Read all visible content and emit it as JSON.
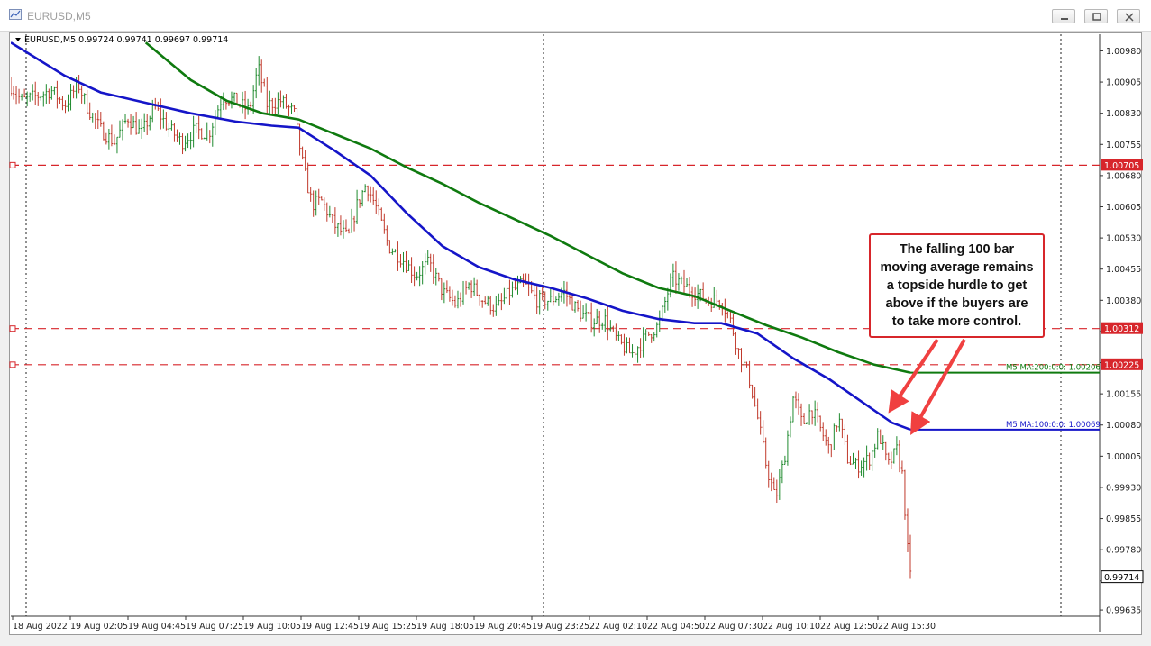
{
  "window": {
    "title": "EURUSD,M5"
  },
  "chart_data": {
    "type": "candlestick",
    "symbol_header": "EURUSD,M5  0.99724 0.99741 0.99697 0.99714",
    "y_ticks": [
      1.0098,
      1.00905,
      1.0083,
      1.00755,
      1.0068,
      1.00605,
      1.0053,
      1.00455,
      1.0038,
      1.00305,
      1.0023,
      1.00155,
      1.0008,
      1.00005,
      0.9993,
      0.99855,
      0.9978,
      0.99705,
      0.99635
    ],
    "y_tick_labels": [
      "1.00980",
      "1.00905",
      "1.00830",
      "1.00755",
      "1.00680",
      "1.00605",
      "1.00530",
      "1.00455",
      "1.00380",
      "",
      "",
      "1.00155",
      "1.00080",
      "1.00005",
      "0.99930",
      "0.99855",
      "0.99780",
      "",
      "0.99635"
    ],
    "ylim": [
      0.9962,
      1.0102
    ],
    "x_tick_labels": [
      "18 Aug 2022",
      "19 Aug 02:05",
      "19 Aug 04:45",
      "19 Aug 07:25",
      "19 Aug 10:05",
      "19 Aug 12:45",
      "19 Aug 15:25",
      "19 Aug 18:05",
      "19 Aug 20:45",
      "19 Aug 23:25",
      "22 Aug 02:10",
      "22 Aug 04:50",
      "22 Aug 07:30",
      "22 Aug 10:10",
      "22 Aug 12:50",
      "22 Aug 15:30"
    ],
    "horizontal_levels": [
      {
        "value": 1.00705,
        "label": "1.00705"
      },
      {
        "value": 1.00312,
        "label": "1.00312"
      },
      {
        "value": 1.00225,
        "label": "1.00225"
      }
    ],
    "last_price": {
      "value": 0.99714,
      "label": "0.99714"
    },
    "price_path": [
      [
        0.0,
        1.00895
      ],
      [
        0.012,
        1.0086
      ],
      [
        0.03,
        1.00872
      ],
      [
        0.045,
        1.00885
      ],
      [
        0.06,
        1.0085
      ],
      [
        0.075,
        1.009
      ],
      [
        0.085,
        1.00845
      ],
      [
        0.1,
        1.0079
      ],
      [
        0.115,
        1.0076
      ],
      [
        0.13,
        1.0082
      ],
      [
        0.145,
        1.0078
      ],
      [
        0.16,
        1.00845
      ],
      [
        0.175,
        1.00795
      ],
      [
        0.19,
        1.0076
      ],
      [
        0.205,
        1.0079
      ],
      [
        0.22,
        1.0078
      ],
      [
        0.235,
        1.0087
      ],
      [
        0.25,
        1.0086
      ],
      [
        0.265,
        1.00835
      ],
      [
        0.275,
        1.0094
      ],
      [
        0.285,
        1.0085
      ],
      [
        0.3,
        1.0086
      ],
      [
        0.315,
        1.0083
      ],
      [
        0.325,
        1.007
      ],
      [
        0.335,
        1.0061
      ],
      [
        0.345,
        1.0062
      ],
      [
        0.36,
        1.0056
      ],
      [
        0.375,
        1.0053
      ],
      [
        0.385,
        1.0061
      ],
      [
        0.395,
        1.0066
      ],
      [
        0.405,
        1.0061
      ],
      [
        0.42,
        1.0051
      ],
      [
        0.435,
        1.0048
      ],
      [
        0.45,
        1.0044
      ],
      [
        0.465,
        1.0047
      ],
      [
        0.48,
        1.004
      ],
      [
        0.495,
        1.0037
      ],
      [
        0.51,
        1.0042
      ],
      [
        0.525,
        1.0038
      ],
      [
        0.54,
        1.0036
      ],
      [
        0.555,
        1.004
      ],
      [
        0.57,
        1.0042
      ],
      [
        0.585,
        1.0038
      ],
      [
        0.6,
        1.0038
      ],
      [
        0.615,
        1.004
      ],
      [
        0.63,
        1.00355
      ],
      [
        0.645,
        1.0033
      ],
      [
        0.66,
        1.00335
      ],
      [
        0.675,
        1.0028
      ],
      [
        0.69,
        1.0025
      ],
      [
        0.705,
        1.0029
      ],
      [
        0.72,
        1.0032
      ],
      [
        0.735,
        1.00435
      ],
      [
        0.745,
        1.0042
      ],
      [
        0.76,
        1.004
      ],
      [
        0.775,
        1.0038
      ],
      [
        0.79,
        1.0038
      ],
      [
        0.8,
        1.0033
      ],
      [
        0.81,
        1.0025
      ],
      [
        0.82,
        1.002
      ],
      [
        0.83,
        1.001
      ],
      [
        0.84,
        0.9998
      ],
      [
        0.85,
        0.999
      ],
      [
        0.86,
        1.0
      ],
      [
        0.87,
        1.0015
      ],
      [
        0.88,
        1.0008
      ],
      [
        0.89,
        1.0012
      ],
      [
        0.9,
        1.0007
      ],
      [
        0.91,
        1.0002
      ],
      [
        0.92,
        1.001
      ],
      [
        0.93,
        1.0
      ],
      [
        0.94,
        0.9998
      ],
      [
        0.955,
        1.0
      ],
      [
        0.965,
        1.0006
      ],
      [
        0.975,
        0.9998
      ],
      [
        0.985,
        1.0002
      ],
      [
        0.992,
        0.9995
      ],
      [
        0.996,
        0.998
      ],
      [
        1.0,
        0.99714
      ]
    ],
    "series": [
      {
        "name": "M5 MA:100:0:0: 1.00069",
        "color": "#1515c8",
        "values": [
          [
            0.0,
            1.01
          ],
          [
            0.06,
            1.0092
          ],
          [
            0.1,
            1.0088
          ],
          [
            0.15,
            1.00855
          ],
          [
            0.2,
            1.0083
          ],
          [
            0.25,
            1.0081
          ],
          [
            0.29,
            1.008
          ],
          [
            0.32,
            1.00795
          ],
          [
            0.36,
            1.0074
          ],
          [
            0.4,
            1.0068
          ],
          [
            0.44,
            1.0059
          ],
          [
            0.48,
            1.0051
          ],
          [
            0.52,
            1.0046
          ],
          [
            0.56,
            1.0043
          ],
          [
            0.6,
            1.0041
          ],
          [
            0.64,
            1.00385
          ],
          [
            0.68,
            1.00355
          ],
          [
            0.72,
            1.00335
          ],
          [
            0.76,
            1.00325
          ],
          [
            0.79,
            1.00325
          ],
          [
            0.83,
            1.003
          ],
          [
            0.87,
            1.0024
          ],
          [
            0.91,
            1.0019
          ],
          [
            0.95,
            1.0013
          ],
          [
            0.98,
            1.00085
          ],
          [
            1.0,
            1.00069
          ]
        ]
      },
      {
        "name": "M5 MA:200:0:0: 1.00206",
        "color": "#0f7a0f",
        "values": [
          [
            0.15,
            1.01
          ],
          [
            0.2,
            1.0091
          ],
          [
            0.24,
            1.0086
          ],
          [
            0.28,
            1.0083
          ],
          [
            0.32,
            1.00815
          ],
          [
            0.36,
            1.0078
          ],
          [
            0.4,
            1.00745
          ],
          [
            0.44,
            1.007
          ],
          [
            0.48,
            1.0066
          ],
          [
            0.52,
            1.00615
          ],
          [
            0.56,
            1.00575
          ],
          [
            0.6,
            1.00535
          ],
          [
            0.64,
            1.0049
          ],
          [
            0.68,
            1.00445
          ],
          [
            0.72,
            1.0041
          ],
          [
            0.76,
            1.0039
          ],
          [
            0.8,
            1.00355
          ],
          [
            0.84,
            1.0032
          ],
          [
            0.88,
            1.0029
          ],
          [
            0.92,
            1.00255
          ],
          [
            0.96,
            1.00225
          ],
          [
            1.0,
            1.00206
          ]
        ]
      }
    ],
    "annotation": {
      "text": "The falling 100 bar moving average remains a topside hurdle to get above if the buyers are to take more control.",
      "border_color": "#d7262b",
      "arrow_color": "#f04040"
    },
    "grid": "vertical-dotted",
    "level_line_color": "#d7262b"
  }
}
